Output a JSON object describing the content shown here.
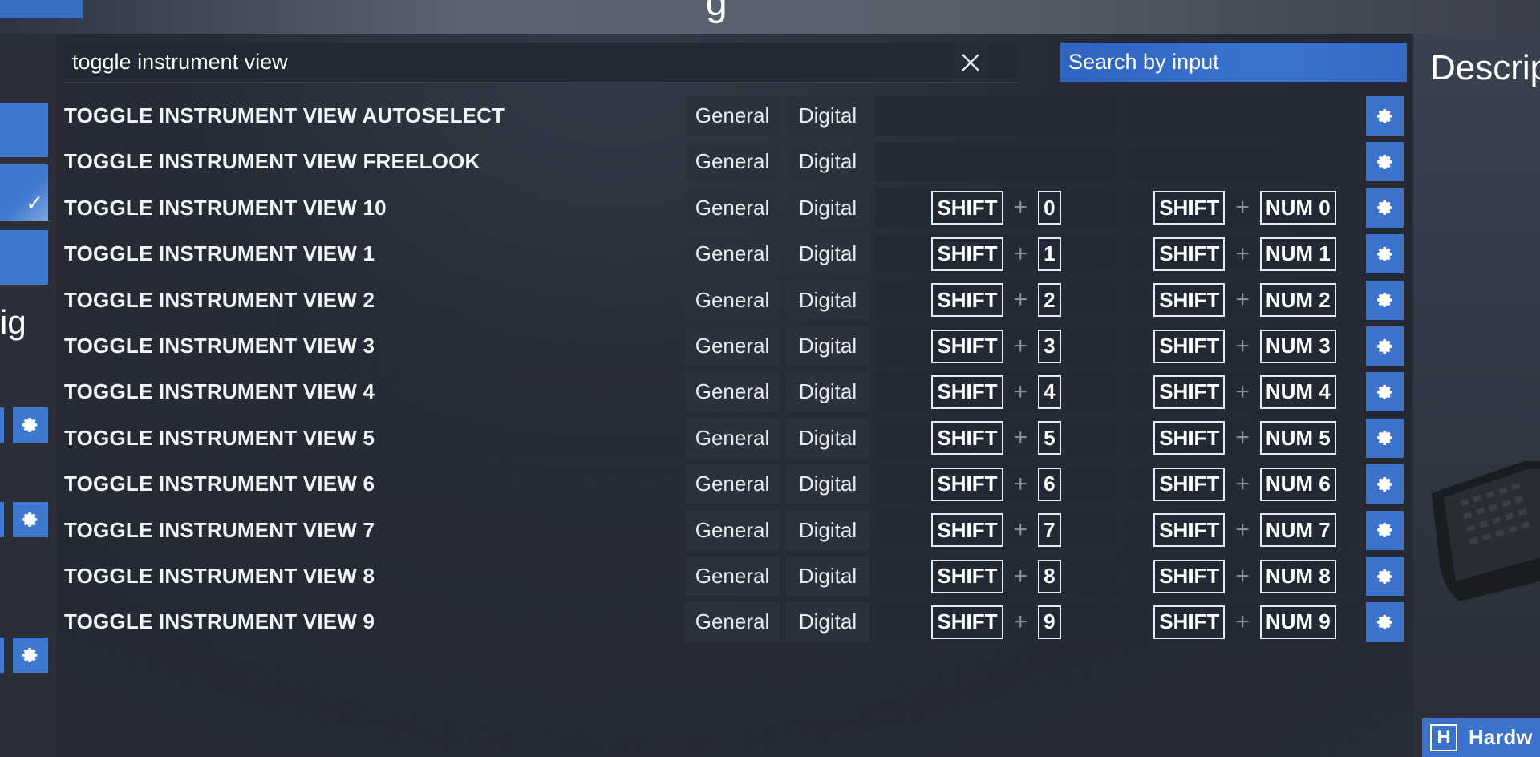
{
  "header": {
    "title_fragment": "g"
  },
  "sidebar": {
    "label_fragment": "ig"
  },
  "search": {
    "value": "toggle instrument view",
    "placeholder": "",
    "search_by_input_label": "Search by input"
  },
  "columns": {
    "category": "General",
    "type": "Digital"
  },
  "bindings": [
    {
      "name": "TOGGLE INSTRUMENT VIEW AUTOSELECT",
      "category": "General",
      "type": "Digital",
      "key1": null,
      "key2": null
    },
    {
      "name": "TOGGLE INSTRUMENT VIEW FREELOOK",
      "category": "General",
      "type": "Digital",
      "key1": null,
      "key2": null
    },
    {
      "name": "TOGGLE INSTRUMENT VIEW 10",
      "category": "General",
      "type": "Digital",
      "key1": [
        "SHIFT",
        "0"
      ],
      "key2": [
        "SHIFT",
        "NUM 0"
      ]
    },
    {
      "name": "TOGGLE INSTRUMENT VIEW 1",
      "category": "General",
      "type": "Digital",
      "key1": [
        "SHIFT",
        "1"
      ],
      "key2": [
        "SHIFT",
        "NUM 1"
      ]
    },
    {
      "name": "TOGGLE INSTRUMENT VIEW 2",
      "category": "General",
      "type": "Digital",
      "key1": [
        "SHIFT",
        "2"
      ],
      "key2": [
        "SHIFT",
        "NUM 2"
      ]
    },
    {
      "name": "TOGGLE INSTRUMENT VIEW 3",
      "category": "General",
      "type": "Digital",
      "key1": [
        "SHIFT",
        "3"
      ],
      "key2": [
        "SHIFT",
        "NUM 3"
      ]
    },
    {
      "name": "TOGGLE INSTRUMENT VIEW 4",
      "category": "General",
      "type": "Digital",
      "key1": [
        "SHIFT",
        "4"
      ],
      "key2": [
        "SHIFT",
        "NUM 4"
      ]
    },
    {
      "name": "TOGGLE INSTRUMENT VIEW 5",
      "category": "General",
      "type": "Digital",
      "key1": [
        "SHIFT",
        "5"
      ],
      "key2": [
        "SHIFT",
        "NUM 5"
      ]
    },
    {
      "name": "TOGGLE INSTRUMENT VIEW 6",
      "category": "General",
      "type": "Digital",
      "key1": [
        "SHIFT",
        "6"
      ],
      "key2": [
        "SHIFT",
        "NUM 6"
      ]
    },
    {
      "name": "TOGGLE INSTRUMENT VIEW 7",
      "category": "General",
      "type": "Digital",
      "key1": [
        "SHIFT",
        "7"
      ],
      "key2": [
        "SHIFT",
        "NUM 7"
      ]
    },
    {
      "name": "TOGGLE INSTRUMENT VIEW 8",
      "category": "General",
      "type": "Digital",
      "key1": [
        "SHIFT",
        "8"
      ],
      "key2": [
        "SHIFT",
        "NUM 8"
      ]
    },
    {
      "name": "TOGGLE INSTRUMENT VIEW 9",
      "category": "General",
      "type": "Digital",
      "key1": [
        "SHIFT",
        "9"
      ],
      "key2": [
        "SHIFT",
        "NUM 9"
      ]
    }
  ],
  "right_panel": {
    "description_fragment": "Descrip",
    "hardware_key": "H",
    "hardware_label_fragment": "Hardw"
  },
  "icons": {
    "clear": "close-icon",
    "settings": "gear-icon",
    "check": "checkmark-icon"
  },
  "colors": {
    "accent": "#3b72cc",
    "background": "#2b313d",
    "cell": "#2c323d"
  }
}
